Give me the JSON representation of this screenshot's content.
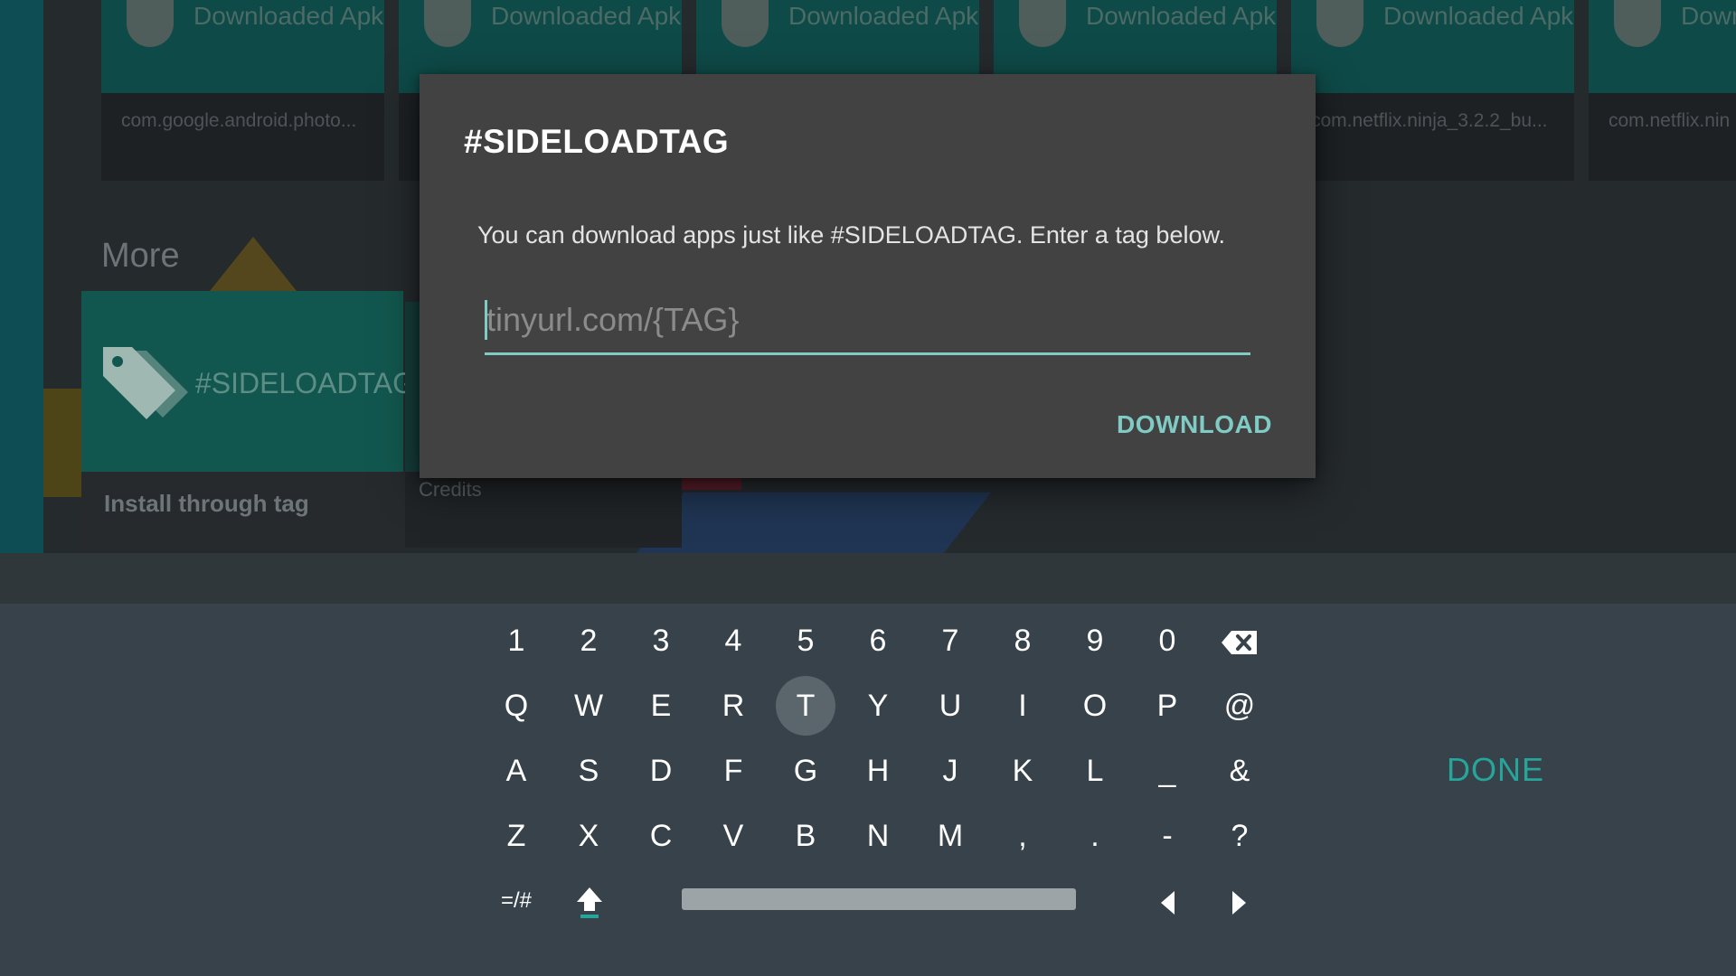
{
  "background": {
    "apk_cards": [
      {
        "title": "Downloaded Apk",
        "subtitle": "com.google.android.photo..."
      },
      {
        "title": "Downloaded Apk",
        "subtitle": ""
      },
      {
        "title": "Downloaded Apk",
        "subtitle": ""
      },
      {
        "title": "Downloaded Apk",
        "subtitle": ""
      },
      {
        "title": "Downloaded Apk",
        "subtitle": "com.netflix.ninja_3.2.2_bu..."
      },
      {
        "title": "Down",
        "subtitle": "com.netflix.nin"
      }
    ],
    "more_heading": "More",
    "tag_card": {
      "icon_text": "#SIDELOADTAGS",
      "label": "Install through tag"
    },
    "credits_card": {
      "label": "Credits"
    }
  },
  "dialog": {
    "title": "#SIDELOADTAG",
    "message": "You can download apps just like #SIDELOADTAG. Enter a tag below.",
    "input_value": "",
    "input_placeholder": "tinyurl.com/{TAG}",
    "download_label": "DOWNLOAD",
    "accent_color": "#80cbc4"
  },
  "keyboard": {
    "rows": [
      [
        "1",
        "2",
        "3",
        "4",
        "5",
        "6",
        "7",
        "8",
        "9",
        "0"
      ],
      [
        "Q",
        "W",
        "E",
        "R",
        "T",
        "Y",
        "U",
        "I",
        "O",
        "P",
        "@"
      ],
      [
        "A",
        "S",
        "D",
        "F",
        "G",
        "H",
        "J",
        "K",
        "L",
        "_",
        "&"
      ],
      [
        "Z",
        "X",
        "C",
        "V",
        "B",
        "N",
        "M",
        ",",
        ".",
        "-",
        "?"
      ]
    ],
    "focused_key": "T",
    "symbols_label": "=/#",
    "done_label": "DONE",
    "icons": {
      "backspace": "backspace-icon",
      "shift": "shift-icon",
      "left": "arrow-left-icon",
      "right": "arrow-right-icon"
    },
    "done_color": "#26a69a"
  }
}
